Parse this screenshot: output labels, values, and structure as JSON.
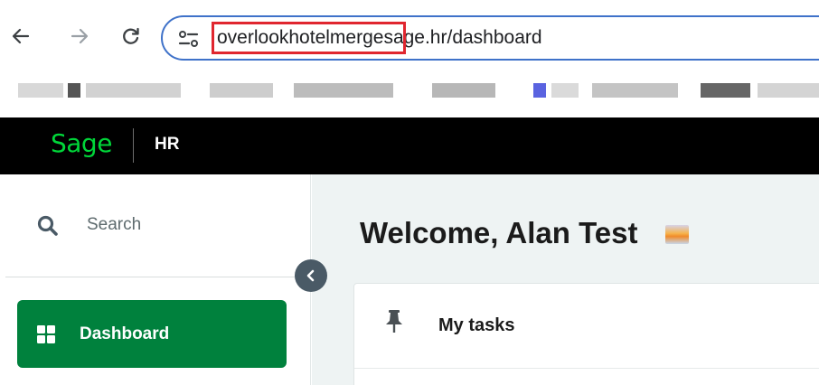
{
  "browser": {
    "url_subdomain": "overlookhotelmerge",
    "url_rest": "sage.hr/dashboard",
    "highlight_color": "#e0262f",
    "omnibox_border_color": "#3f72c9"
  },
  "header": {
    "logo_text": "Sage",
    "product": "HR",
    "logo_color": "#00d639",
    "background": "#000000"
  },
  "sidebar": {
    "search_label": "Search",
    "items": [
      {
        "label": "Dashboard",
        "icon": "grid-icon",
        "active": true,
        "color": "#00813d"
      }
    ]
  },
  "main": {
    "welcome": "Welcome, Alan Test",
    "welcome_emoji": "sunrise-emoji",
    "cards": [
      {
        "title": "My tasks",
        "icon": "pin-icon"
      }
    ]
  }
}
